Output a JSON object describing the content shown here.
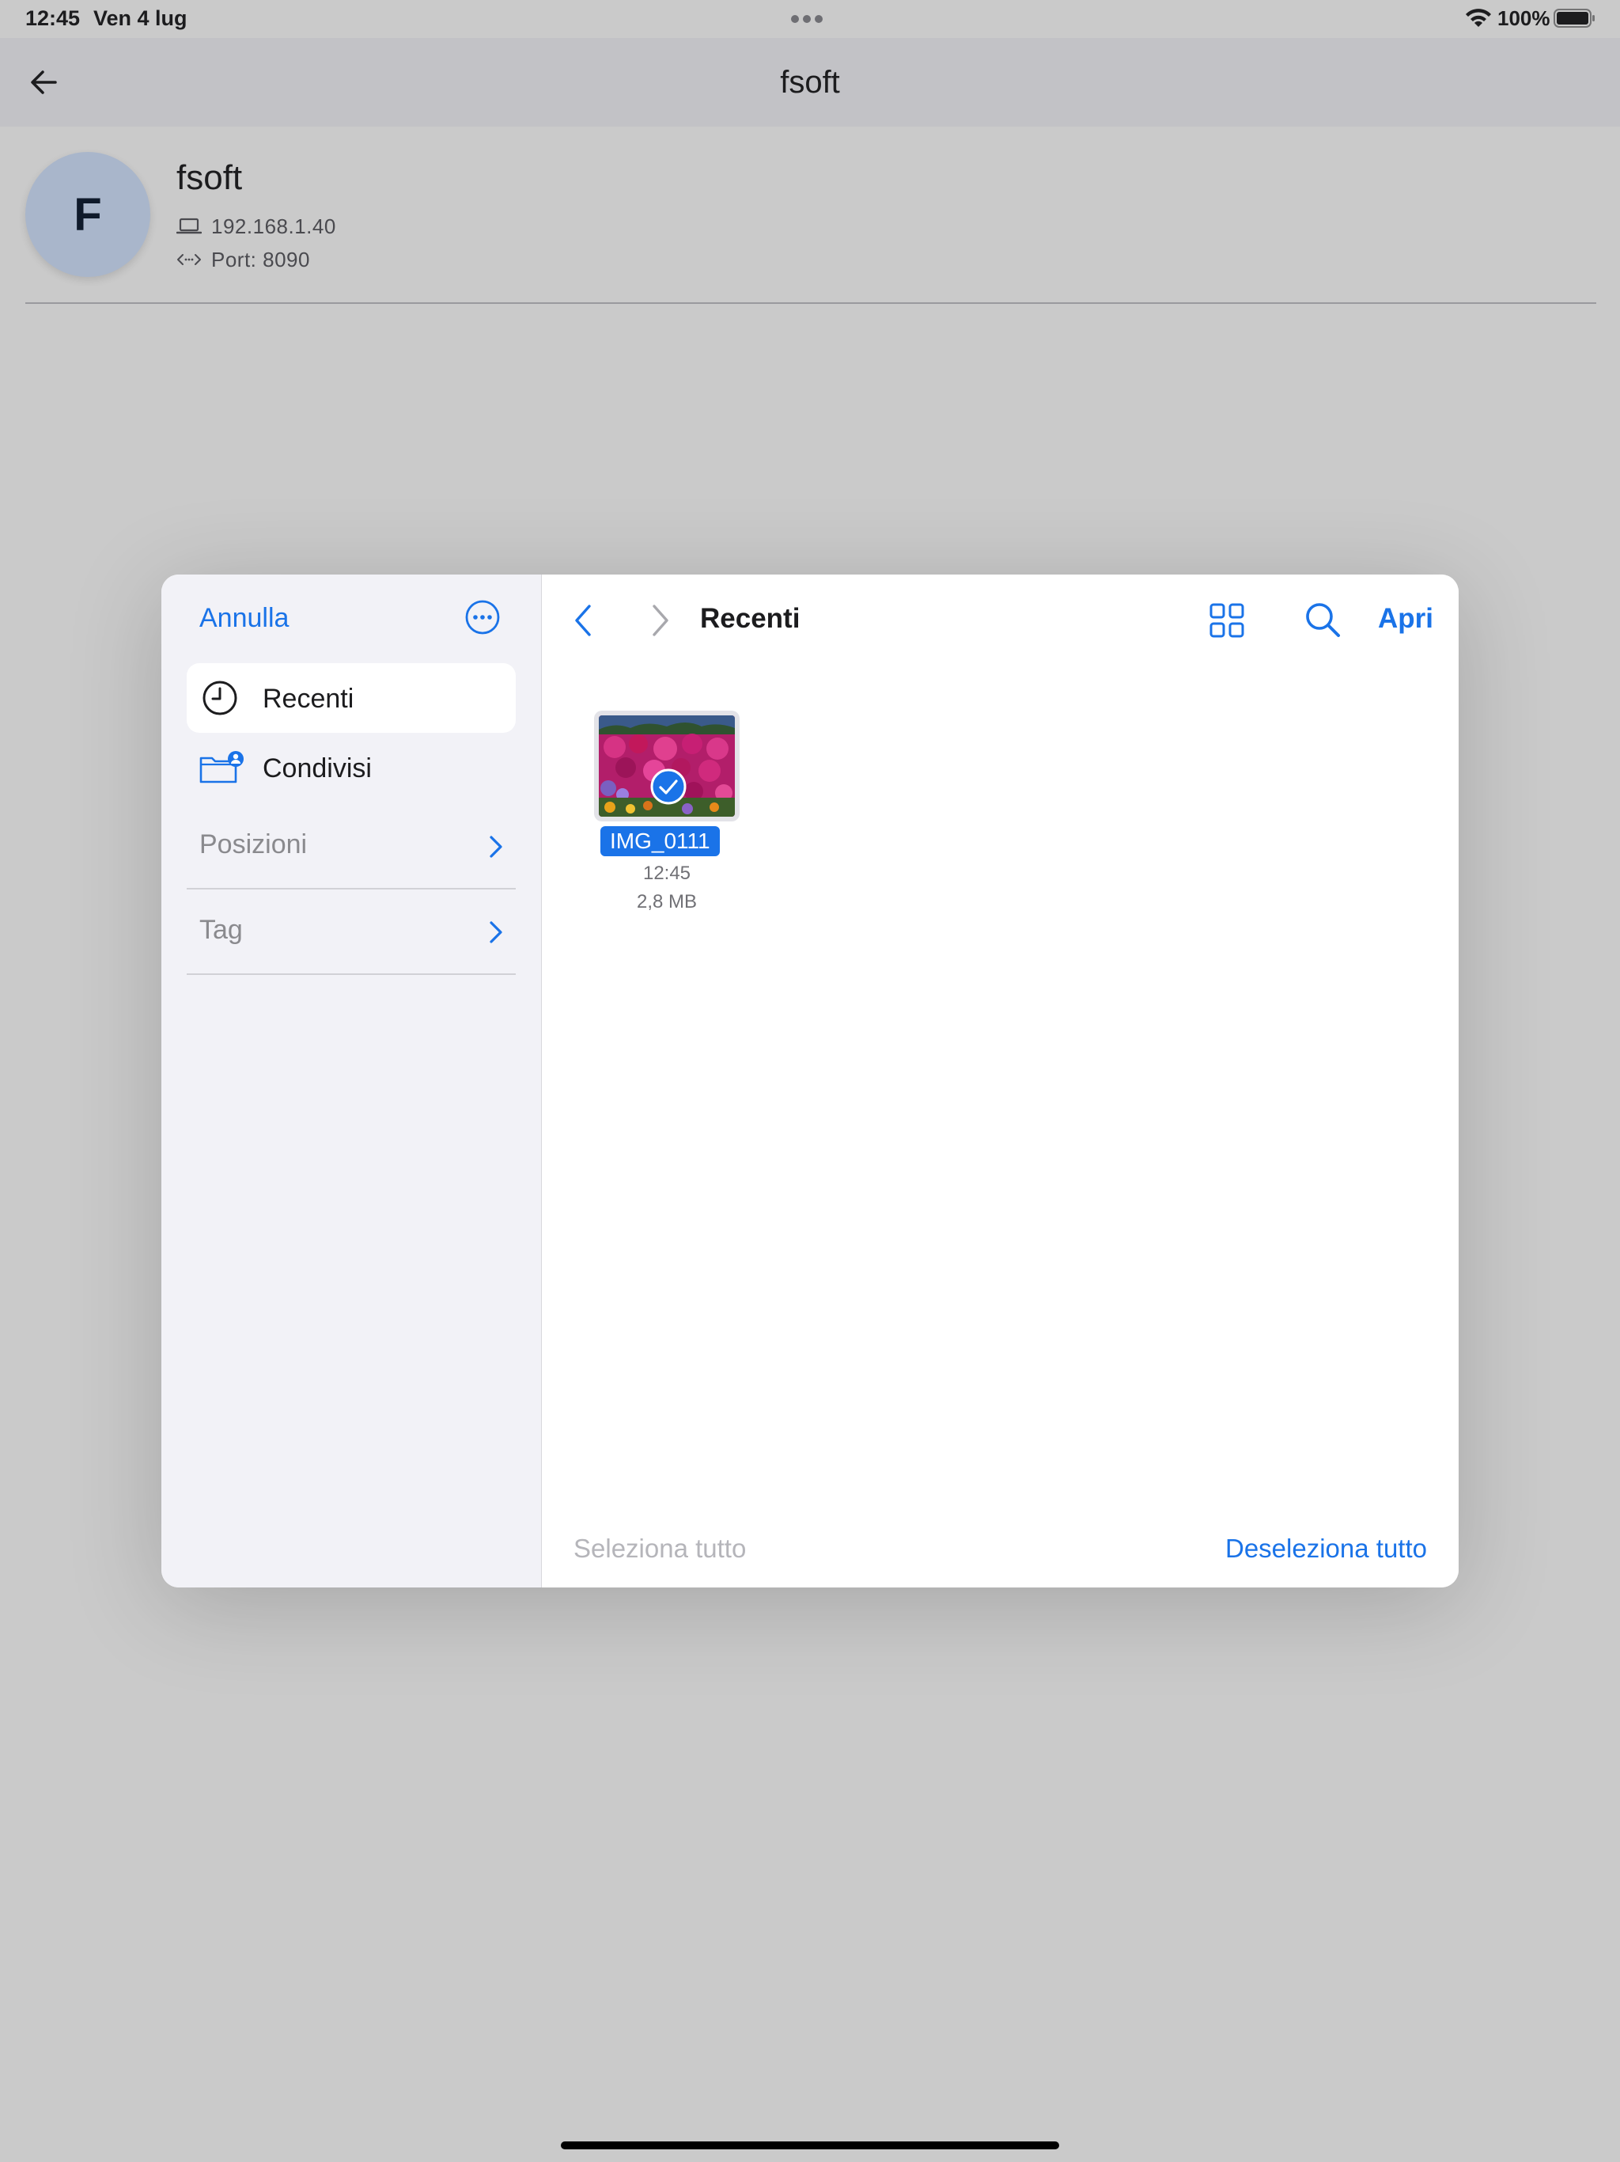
{
  "status_bar": {
    "time": "12:45",
    "date": "Ven 4 lug",
    "battery": "100%"
  },
  "app": {
    "title": "fsoft",
    "device": {
      "avatar_letter": "F",
      "name": "fsoft",
      "ip": "192.168.1.40",
      "port": "Port: 8090"
    }
  },
  "picker": {
    "sidebar": {
      "cancel_label": "Annulla",
      "items": [
        {
          "label": "Recenti",
          "icon": "clock-icon",
          "active": true
        },
        {
          "label": "Condivisi",
          "icon": "shared-folder-icon",
          "active": false
        }
      ],
      "sections": [
        {
          "label": "Posizioni"
        },
        {
          "label": "Tag"
        }
      ]
    },
    "toolbar": {
      "folder_title": "Recenti",
      "open_label": "Apri"
    },
    "files": [
      {
        "name": "IMG_0111",
        "time": "12:45",
        "size": "2,8 MB",
        "selected": true
      }
    ],
    "footer": {
      "select_all": "Seleziona tutto",
      "deselect_all": "Deseleziona tutto"
    }
  },
  "colors": {
    "accent": "#1a73e8",
    "background_dim": "#cacaca",
    "sidebar_bg": "#f2f2f7"
  }
}
